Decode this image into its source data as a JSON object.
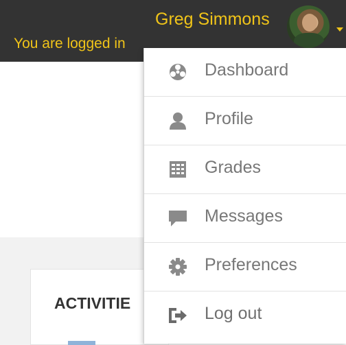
{
  "header": {
    "logged_in_text": "You are logged in",
    "user_name": "Greg Simmons"
  },
  "page": {
    "activities_heading": "ACTIVITIE"
  },
  "user_menu": {
    "items": [
      {
        "label": "Dashboard",
        "icon": "dashboard-icon"
      },
      {
        "label": "Profile",
        "icon": "user-icon"
      },
      {
        "label": "Grades",
        "icon": "table-icon"
      },
      {
        "label": "Messages",
        "icon": "comment-icon"
      },
      {
        "label": "Preferences",
        "icon": "gear-icon"
      },
      {
        "label": "Log out",
        "icon": "sign-out-icon"
      }
    ]
  },
  "colors": {
    "topbar": "#333333",
    "accent_text": "#f0c419",
    "menu_text": "#777777",
    "highlight": "#ffff1a"
  }
}
